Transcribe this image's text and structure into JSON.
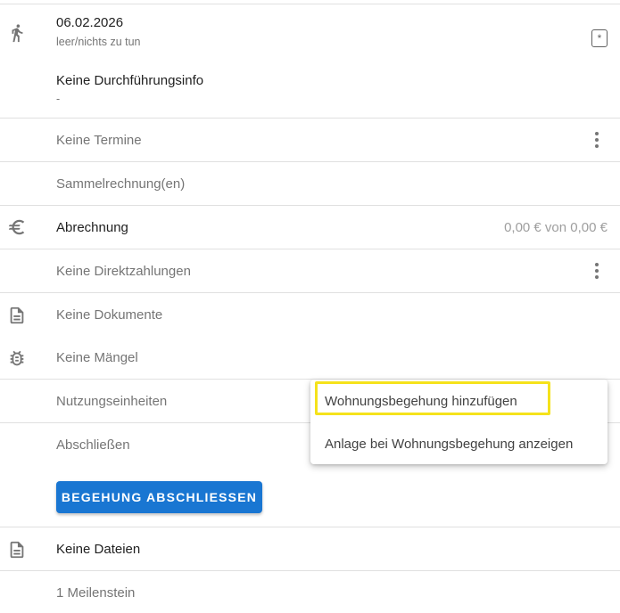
{
  "entry": {
    "date": "06.02.2026",
    "status": "leer/nichts zu tun",
    "execution_title": "Keine Durchführungsinfo",
    "execution_value": "-",
    "star_symbol": "*"
  },
  "rows": {
    "termine": "Keine Termine",
    "sammelrechnung": "Sammelrechnung(en)",
    "abrechnung": "Abrechnung",
    "abrechnung_amount": "0,00 € von 0,00 €",
    "direktzahlungen": "Keine Direktzahlungen",
    "dokumente": "Keine Dokumente",
    "maengel": "Keine Mängel",
    "nutzungseinheiten": "Nutzungseinheiten",
    "abschliessen": "Abschließen",
    "dateien": "Keine Dateien",
    "meilenstein": "1 Meilenstein"
  },
  "button": {
    "label": "BEGEHUNG ABSCHLIESSEN"
  },
  "menu": {
    "items": [
      {
        "label": "Wohnungsbegehung hinzufügen"
      },
      {
        "label": "Anlage bei Wohnungsbegehung anzeigen"
      }
    ]
  },
  "icons": {
    "walk": "person-walking-icon",
    "euro": "euro-icon",
    "document": "document-icon",
    "bug": "bug-icon",
    "file": "file-icon"
  },
  "colors": {
    "primary": "#1976d2",
    "highlight": "#f5e21b",
    "grey_text": "#757575"
  }
}
